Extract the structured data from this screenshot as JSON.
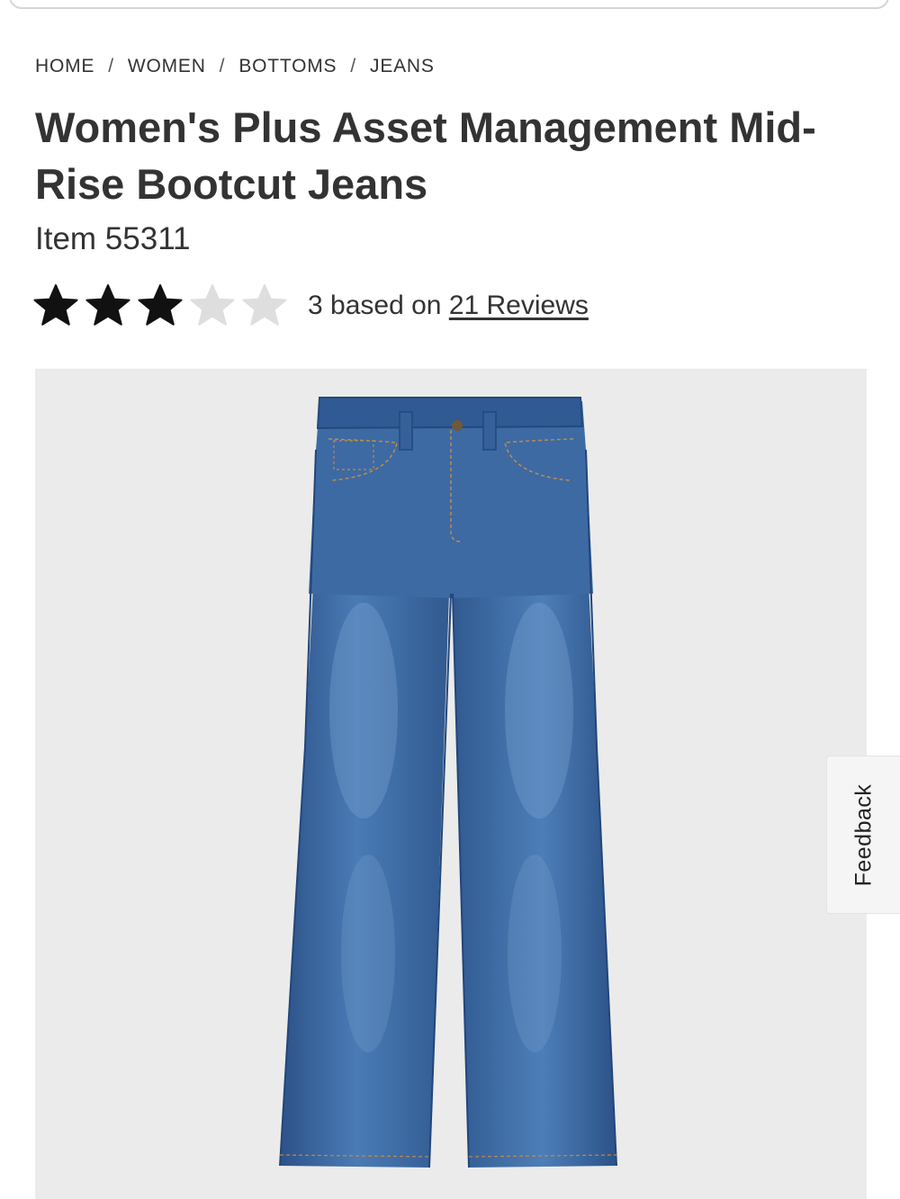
{
  "breadcrumb": {
    "items": [
      "HOME",
      "WOMEN",
      "BOTTOMS",
      "JEANS"
    ],
    "separator": "/"
  },
  "product": {
    "title": "Women's Plus Asset Management Mid-Rise Bootcut Jeans",
    "item_number": "Item 55311",
    "rating": {
      "value": 3,
      "max": 5,
      "text_prefix": "3 based on",
      "reviews_link": "21 Reviews"
    },
    "image": {
      "background_color": "#ebebeb",
      "denim_color": "#3f6ea6"
    }
  },
  "feedback_tab": {
    "label": "Feedback"
  },
  "colors": {
    "text": "#333333",
    "star_filled": "#111111",
    "star_empty": "#dedede"
  },
  "icons": {
    "rating_star": "star-icon"
  }
}
